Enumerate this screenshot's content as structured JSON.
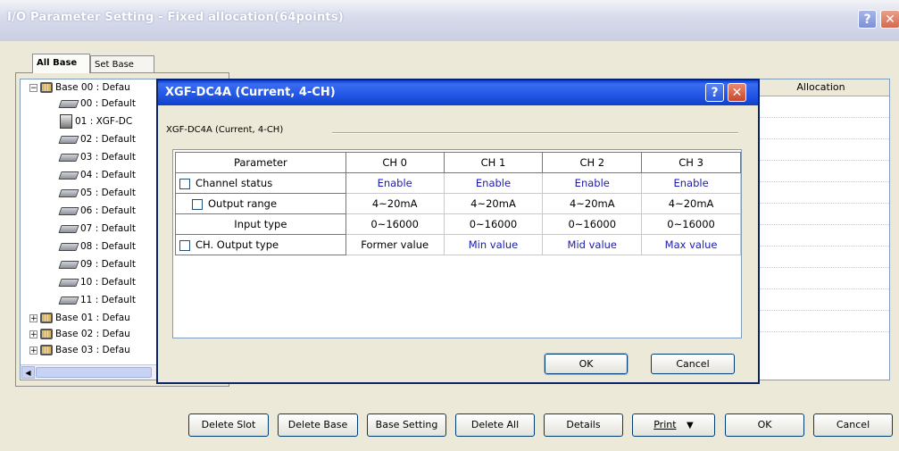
{
  "window": {
    "title": "I/O Parameter Setting - Fixed allocation(64points)",
    "help_label": "?",
    "close_label": "✕"
  },
  "tabs": [
    {
      "label": "All Base",
      "active": true
    },
    {
      "label": "Set Base",
      "active": false
    }
  ],
  "tree": {
    "base00": "Base 00 : Defau",
    "slots": [
      "00 : Default",
      "01 : XGF-DC",
      "02 : Default",
      "03 : Default",
      "04 : Default",
      "05 : Default",
      "06 : Default",
      "07 : Default",
      "08 : Default",
      "09 : Default",
      "10 : Default",
      "11 : Default"
    ],
    "bases": [
      "Base 01 : Defau",
      "Base 02 : Defau",
      "Base 03 : Defau"
    ]
  },
  "grid": {
    "allocation_header": "Allocation"
  },
  "dialog": {
    "title": "XGF-DC4A (Current, 4-CH)",
    "subtitle": "XGF-DC4A (Current, 4-CH)",
    "help_label": "?",
    "close_label": "✕",
    "columns": [
      "Parameter",
      "CH 0",
      "CH 1",
      "CH 2",
      "CH 3"
    ],
    "rows": [
      {
        "param": "Channel status",
        "checkbox": true,
        "values": [
          "Enable",
          "Enable",
          "Enable",
          "Enable"
        ]
      },
      {
        "param": "Output range",
        "checkbox": true,
        "values": [
          "4~20mA",
          "4~20mA",
          "4~20mA",
          "4~20mA"
        ]
      },
      {
        "param": "Input type",
        "checkbox": false,
        "values": [
          "0~16000",
          "0~16000",
          "0~16000",
          "0~16000"
        ]
      },
      {
        "param": "CH. Output type",
        "checkbox": true,
        "values": [
          "Former value",
          "Min value",
          "Mid value",
          "Max value"
        ]
      }
    ],
    "ok_label": "OK",
    "cancel_label": "Cancel"
  },
  "buttons": {
    "delete_slot": "Delete Slot",
    "delete_base": "Delete Base",
    "base_setting": "Base Setting",
    "delete_all": "Delete All",
    "details": "Details",
    "print": "Print",
    "print_arrow": "▼",
    "ok": "OK",
    "cancel": "Cancel"
  },
  "colors": {
    "dialog_title_bar": "#2256e6",
    "value_blue": "#1a1ab0"
  }
}
